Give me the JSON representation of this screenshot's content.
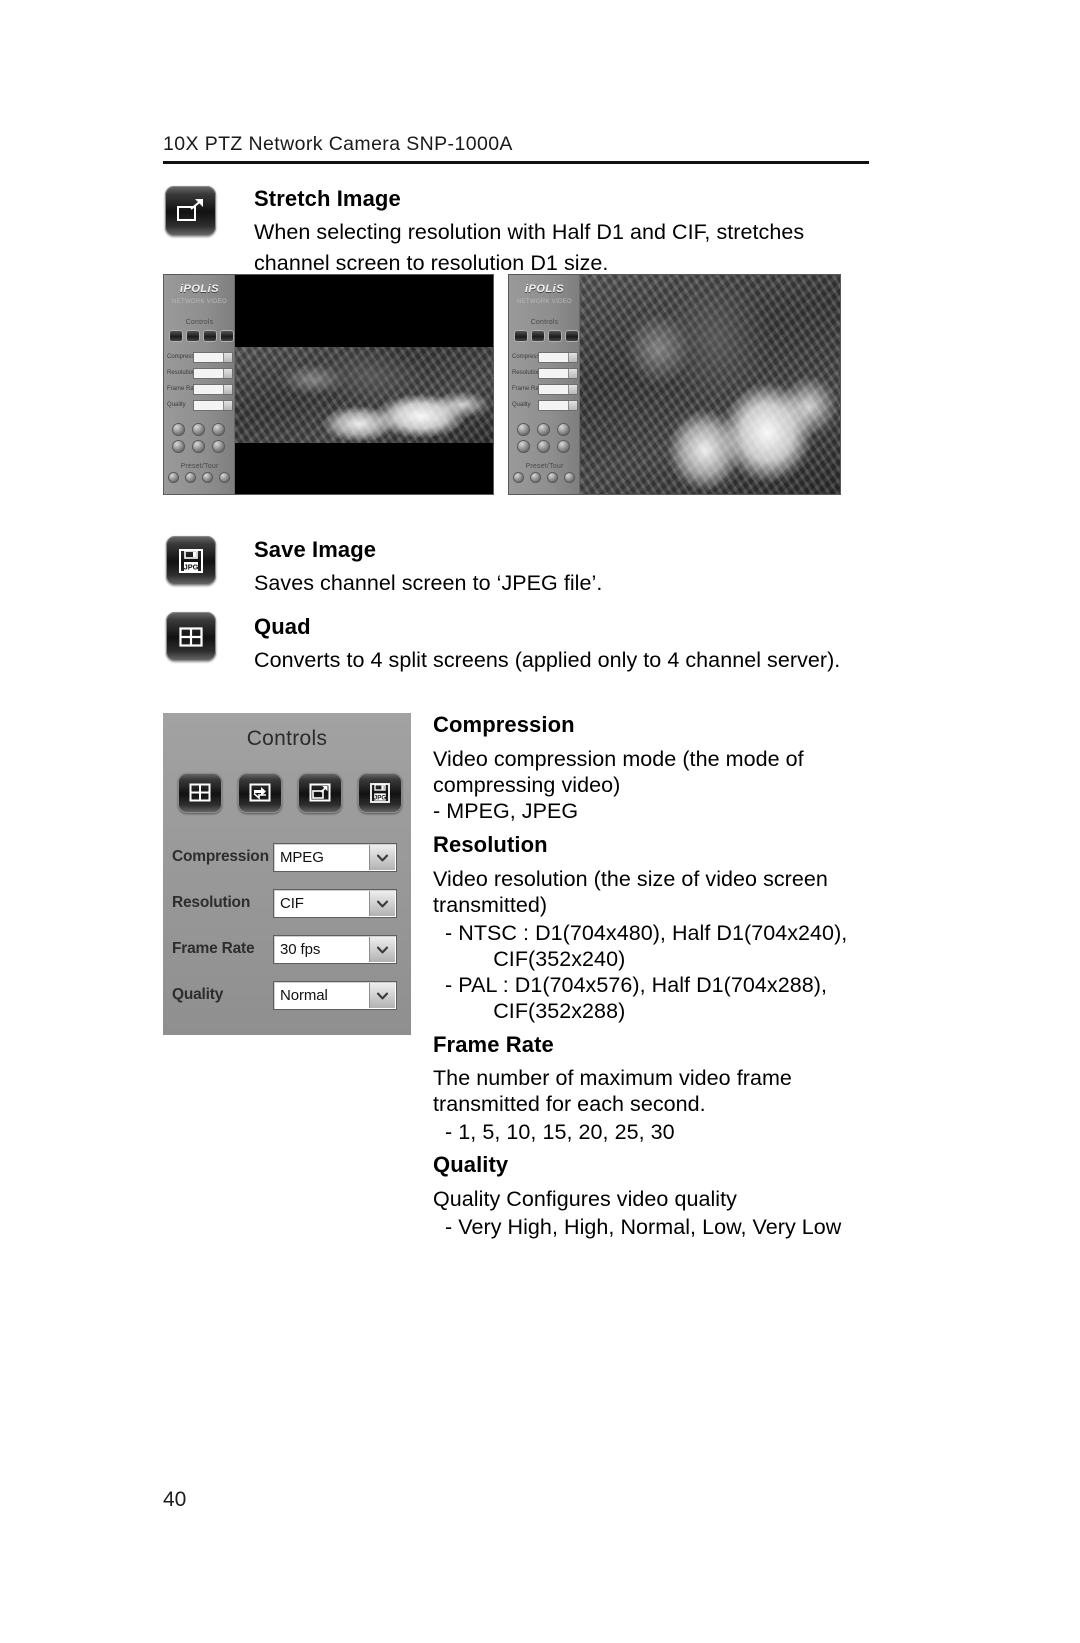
{
  "header": {
    "running_head": "10X PTZ Network Camera SNP-1000A"
  },
  "sections": [
    {
      "icon": "stretch-image-icon",
      "title": "Stretch Image",
      "body": "When selecting resolution with Half D1 and CIF, stretches channel screen to resolution D1 size."
    },
    {
      "icon": "save-image-jpg-icon",
      "title": "Save Image",
      "body": "Saves channel screen to ‘JPEG file’."
    },
    {
      "icon": "quad-icon",
      "title": "Quad",
      "body": "Converts to 4 split screens (applied only to 4 channel server)."
    }
  ],
  "figures": {
    "left": {
      "name": "viewer-screenshot-unstretched",
      "logo": "iPOLiS",
      "sublogo": "NETWORK VIDEO",
      "panel_caption": "Controls",
      "preset_caption": "Preset/Tour",
      "rows": [
        "Compression",
        "Resolution",
        "Frame Rate",
        "Quality"
      ]
    },
    "right": {
      "name": "viewer-screenshot-stretched",
      "logo": "iPOLiS",
      "sublogo": "NETWORK VIDEO",
      "panel_caption": "Controls",
      "preset_caption": "Preset/Tour",
      "rows": [
        "Compression",
        "Resolution",
        "Frame Rate",
        "Quality"
      ]
    }
  },
  "controls_panel": {
    "title": "Controls",
    "buttons": [
      {
        "name": "quad-button",
        "icon": "quad-icon"
      },
      {
        "name": "refresh-button",
        "icon": "refresh-arrows-icon"
      },
      {
        "name": "stretch-button",
        "icon": "stretch-image-icon"
      },
      {
        "name": "save-jpg-button",
        "icon": "save-image-jpg-icon"
      }
    ],
    "rows": [
      {
        "label": "Compression",
        "value": "MPEG"
      },
      {
        "label": "Resolution",
        "value": "CIF"
      },
      {
        "label": "Frame Rate",
        "value": "30 fps"
      },
      {
        "label": "Quality",
        "value": "Normal"
      }
    ]
  },
  "descriptions": [
    {
      "title": "Compression",
      "lines": [
        "Video compression mode (the mode of",
        "compressing video)",
        "- MPEG, JPEG"
      ]
    },
    {
      "title": "Resolution",
      "lines": [
        "Video resolution (the size of video screen",
        "transmitted)",
        "  - NTSC : D1(704x480), Half D1(704x240),",
        "          CIF(352x240)",
        "  - PAL : D1(704x576), Half D1(704x288),",
        "          CIF(352x288)"
      ]
    },
    {
      "title": "Frame Rate",
      "lines": [
        "The number of maximum video frame",
        "transmitted for each second.",
        "  - 1, 5, 10, 15, 20, 25, 30"
      ]
    },
    {
      "title": "Quality",
      "lines": [
        "Quality Configures video quality",
        "  - Very High, High, Normal, Low, Very Low"
      ]
    }
  ],
  "footer": {
    "page_number": "40"
  }
}
